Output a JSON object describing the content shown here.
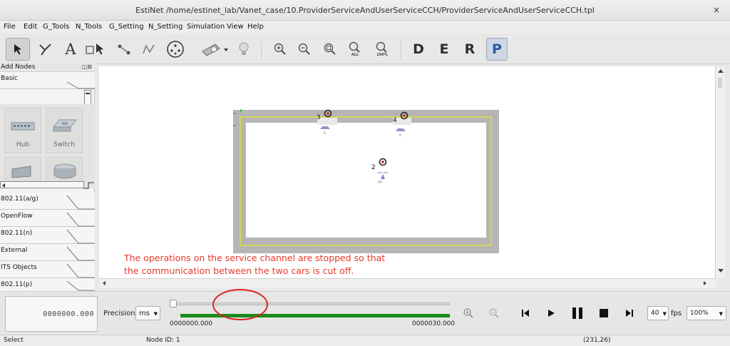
{
  "window": {
    "title": "EstiNet /home/estinet_lab/Vanet_case/10.ProviderServiceAndUserServiceCCH/ProviderServiceAndUserServiceCCH.tpl",
    "close_glyph": "×"
  },
  "menu": [
    "File",
    "Edit",
    "G_Tools",
    "N_Tools",
    "G_Setting",
    "N_Setting",
    "Simulation",
    "View",
    "Help"
  ],
  "toolbar": {
    "tools": [
      "select-arrow-icon",
      "wire-icon",
      "text-tool-icon",
      "rectangle-icon",
      "pointer-arrow-icon",
      "link-icon",
      "pen-icon",
      "wireless-range-icon",
      "ruler-icon",
      "lightbulb-icon"
    ],
    "text_tool_label": "A",
    "zoom_labels": {
      "all": "ALL",
      "full": "100%"
    },
    "mode_buttons": [
      "D",
      "E",
      "R",
      "P"
    ],
    "active_mode": "P"
  },
  "left_panel": {
    "title": "Add Nodes",
    "header_icons": "◫⊠",
    "categories_top": [
      "Basic"
    ],
    "node_items": [
      "Hub",
      "Switch"
    ],
    "categories_bottom": [
      "802.11(a/g)",
      "OpenFlow",
      "802.11(n)",
      "External",
      "ITS Objects",
      "802.11(p)"
    ]
  },
  "canvas": {
    "node_labels": [
      "3",
      "4",
      "2"
    ],
    "small_labels": [
      "A",
      "A",
      "ITP"
    ],
    "annotation": [
      "The operations on the service channel are stopped so that",
      "the communication between the two cars is cut off."
    ]
  },
  "playback": {
    "time_display": "0000000.000",
    "precision_label": "Precision",
    "precision_value": "ms",
    "start_time": "0000000.000",
    "end_time": "0000030.000",
    "slider_position": 0.0,
    "progress_fraction": 1.0,
    "fps_value": "40",
    "fps_label": "fps",
    "zoom_value": "100%"
  },
  "status": {
    "mode": "Select",
    "node_id": "Node ID: 1",
    "coords": "(231,26)"
  },
  "colors": {
    "road": "#b5b5b5",
    "lane_line": "#e8e820",
    "annotation_text": "#e53a2a",
    "progress": "#1a8c1a",
    "highlight_ellipse": "#dd2222"
  }
}
